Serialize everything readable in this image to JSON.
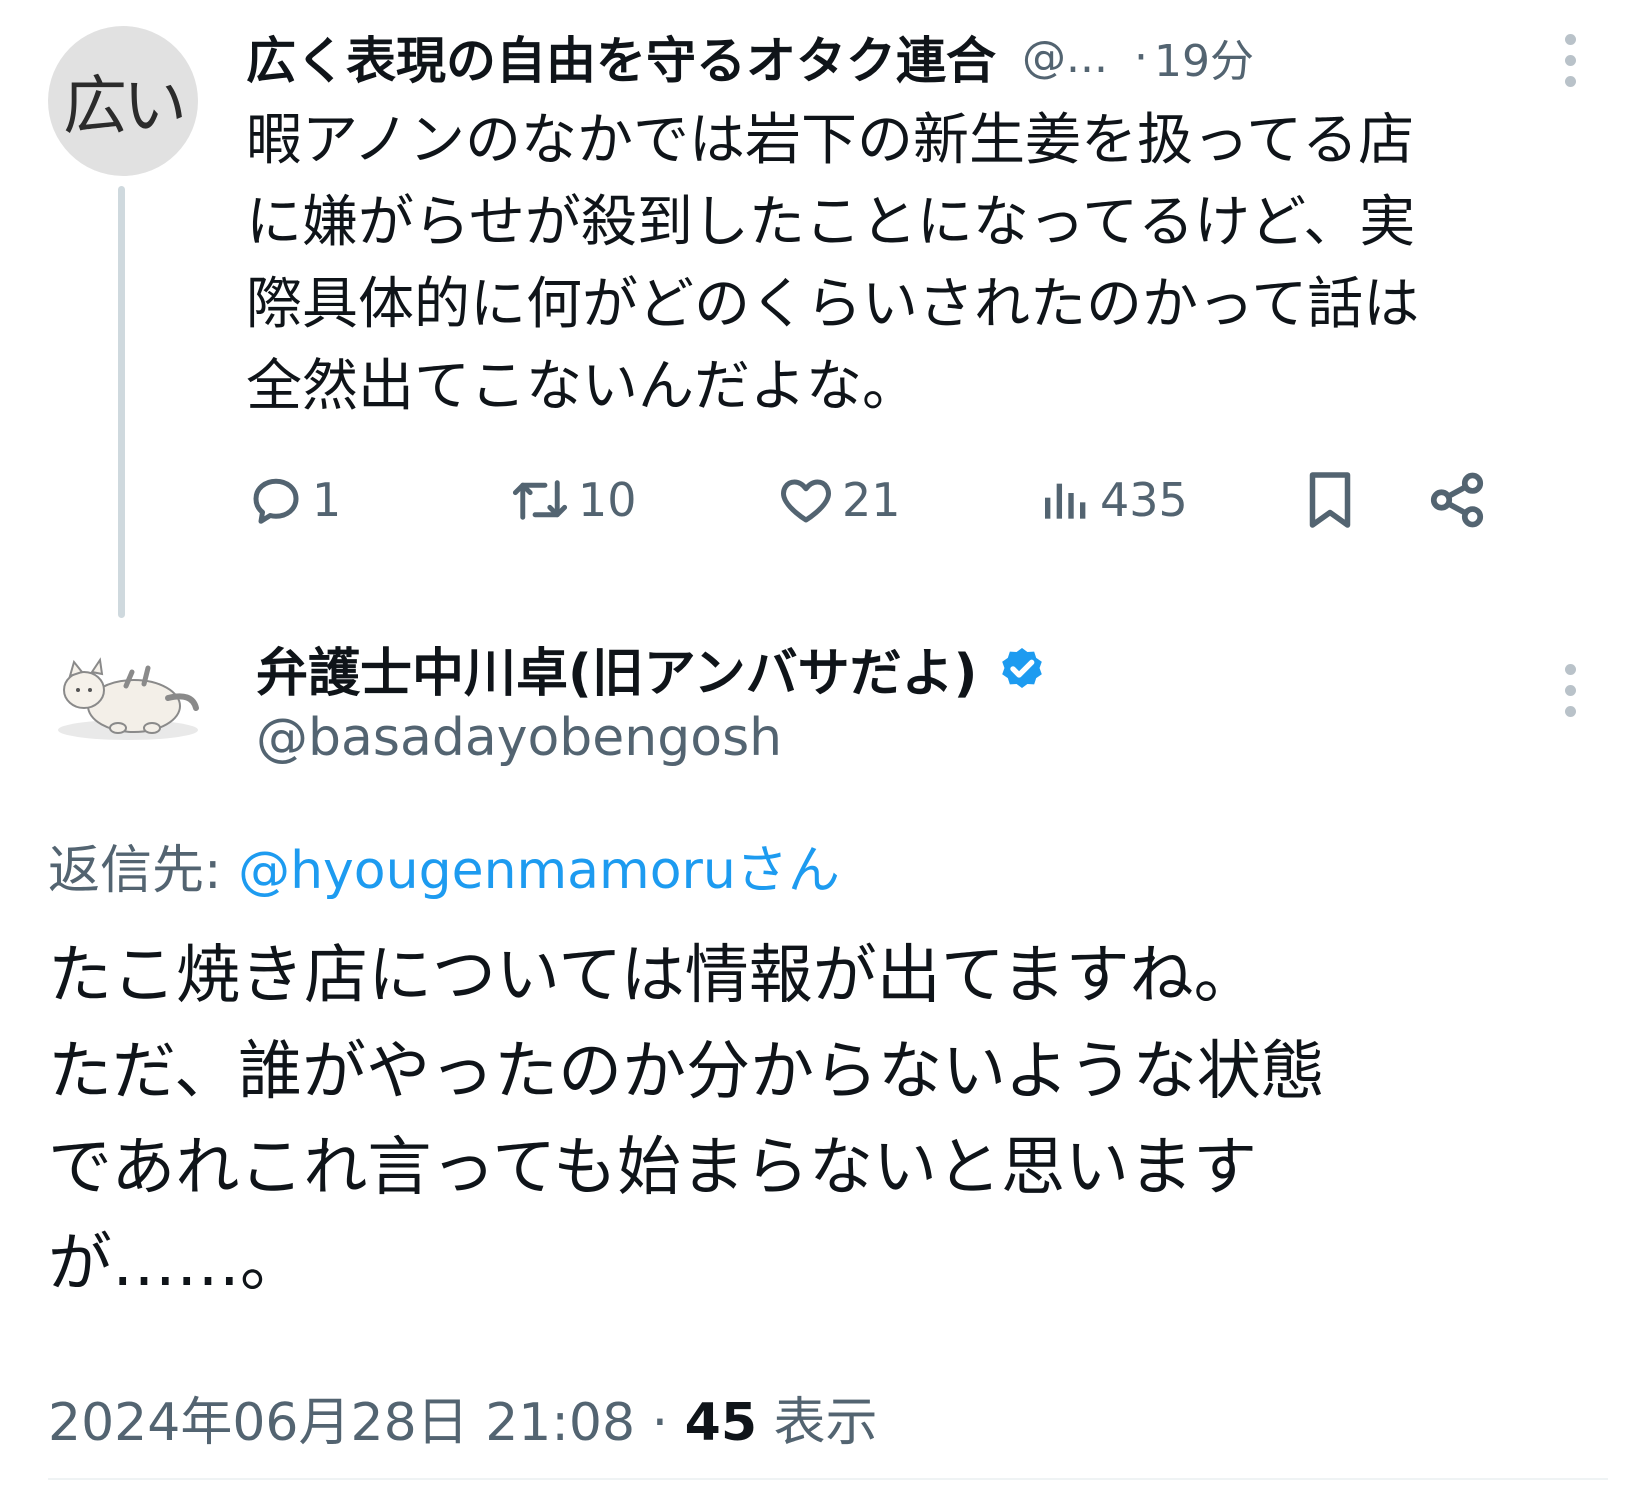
{
  "parent_tweet": {
    "avatar_text": "広い",
    "display_name": "広く表現の自由を守るオタク連合",
    "handle": "@...",
    "separator": "·",
    "time": "19分",
    "text": "暇アノンのなかでは岩下の新生姜を扱ってる店\nに嫌がらせが殺到したことになってるけど、実\n際具体的に何がどのくらいされたのかって話は\n全然出てこないんだよな。",
    "actions": {
      "reply_count": "1",
      "retweet_count": "10",
      "like_count": "21",
      "view_count": "435"
    }
  },
  "main_tweet": {
    "display_name": "弁護士中川卓(旧アンバサだよ)",
    "handle": "@basadayobengosh",
    "reply_prefix": "返信先: ",
    "reply_target": "@hyougenmamoruさん",
    "text": "たこ焼き店については情報が出てますね。\nただ、誰がやったのか分からないような状態\nであれこれ言っても始まらないと思います\nが……。",
    "timestamp": "2024年06月28日 21:08",
    "meta_separator": " · ",
    "views_count": "45",
    "views_label": " 表示"
  },
  "colors": {
    "text_primary": "#0f1419",
    "text_secondary": "#536471",
    "link": "#1d9bf0",
    "verified_badge": "#1d9bf0",
    "thread_line": "#cfd9de"
  },
  "icons": [
    "reply-icon",
    "retweet-icon",
    "like-icon",
    "views-icon",
    "bookmark-icon",
    "share-icon",
    "more-icon",
    "verified-badge-icon"
  ]
}
